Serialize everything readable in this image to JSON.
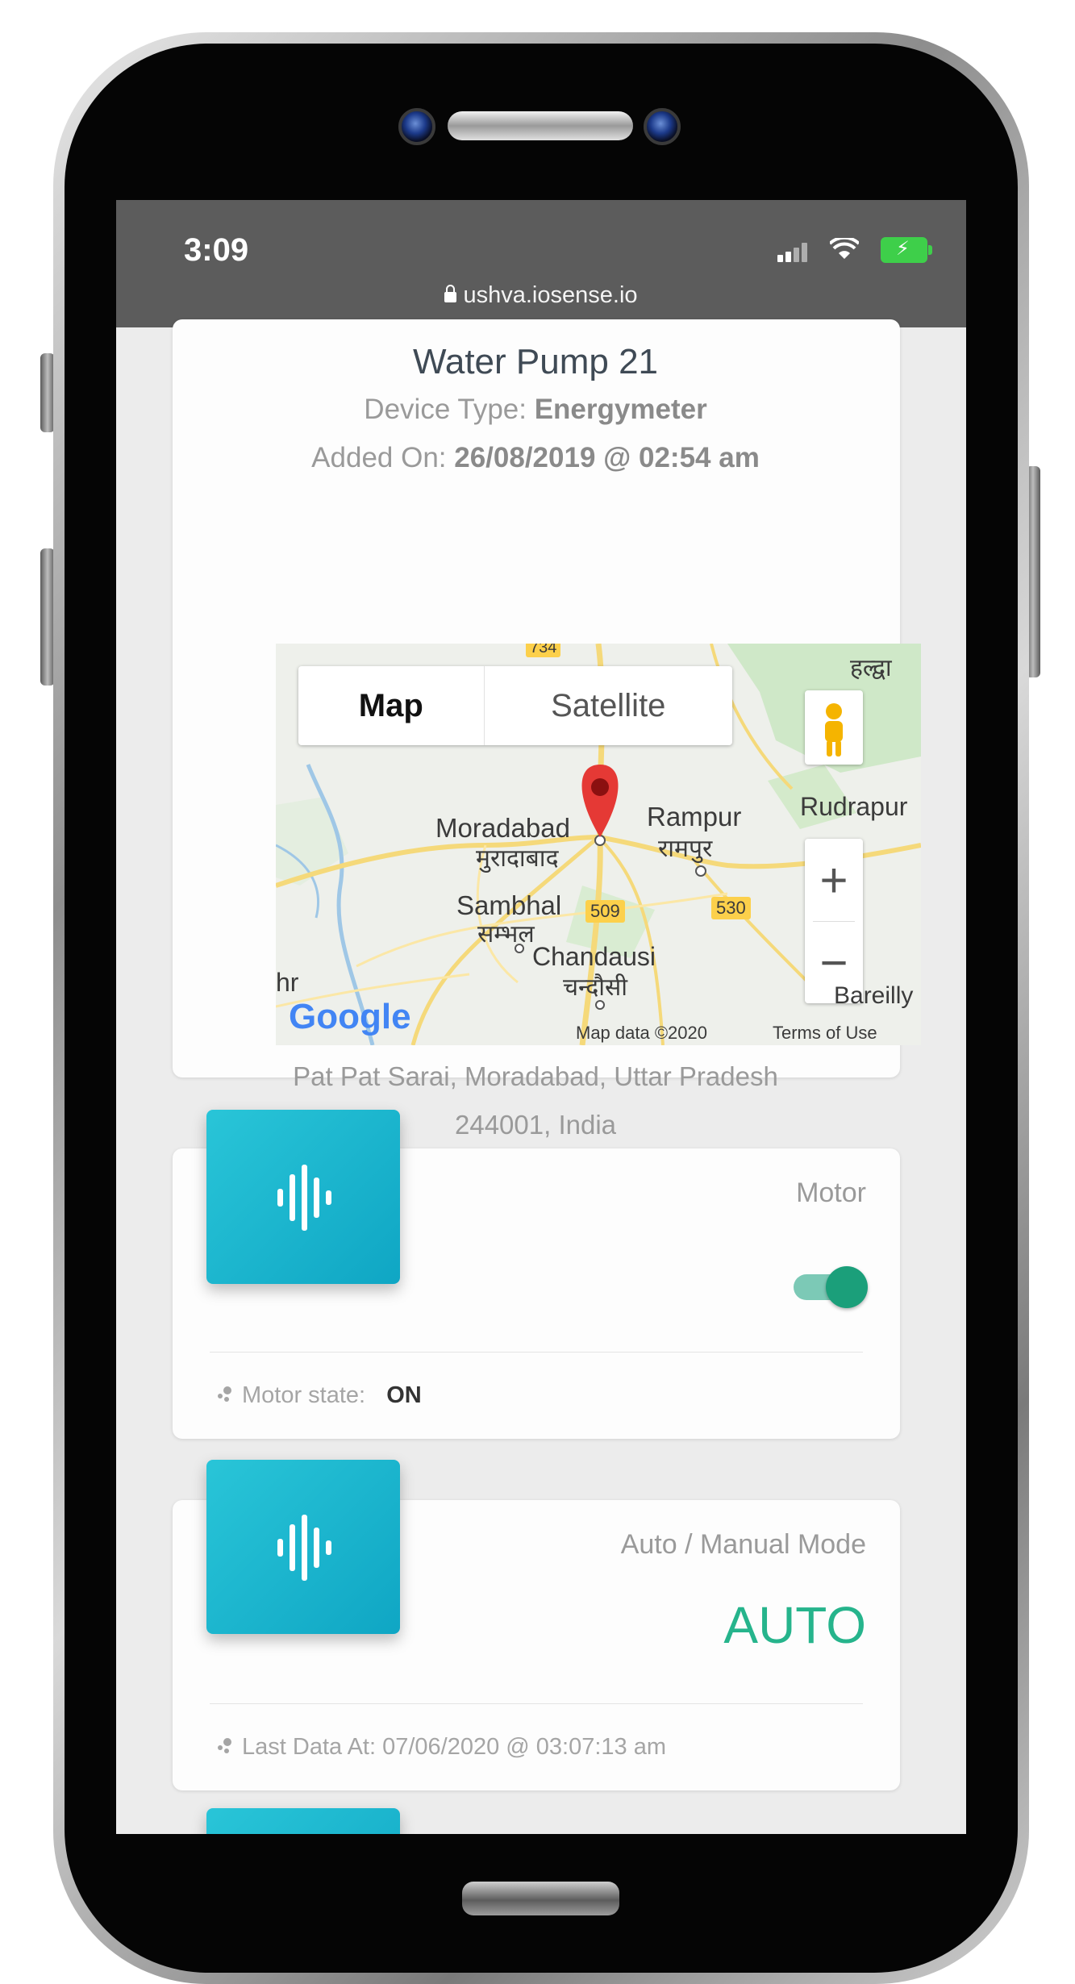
{
  "status_bar": {
    "time": "3:09",
    "url": "ushva.iosense.io",
    "icons": [
      "lock-icon",
      "cell-signal-icon",
      "wifi-icon",
      "battery-charging-icon"
    ]
  },
  "device_card": {
    "title": "Water Pump 21",
    "device_type_label": "Device Type: ",
    "device_type_value": "Energymeter",
    "added_on_label": "Added On: ",
    "added_on_value": "26/08/2019 @ 02:54 am",
    "address_line1": "Pat Pat Sarai, Moradabad, Uttar Pradesh",
    "address_line2": "244001, India"
  },
  "map": {
    "tab_map": "Map",
    "tab_satellite": "Satellite",
    "zoom_in": "+",
    "zoom_out": "−",
    "google": "Google",
    "attribution": "Map data ©2020",
    "terms": "Terms of Use",
    "labels": {
      "moradabad": "Moradabad",
      "moradabad_hi": "मुरादाबाद",
      "rampur": "Rampur",
      "rampur_hi": "रामपुर",
      "rudrapur": "Rudrapur",
      "sambhal": "Sambhal",
      "sambhal_hi": "सम्भल",
      "chandausi": "Chandausi",
      "chandausi_hi": "चन्दौसी",
      "haldwani_hi": "हल्द्वा",
      "bareilly": "Bareilly",
      "hr": "hr",
      "road_509": "509",
      "road_530": "530",
      "road_734": "734"
    }
  },
  "motor_card": {
    "title": "Motor",
    "toggle_on": true,
    "state_label": "Motor state:",
    "state_value": "ON"
  },
  "mode_card": {
    "title": "Auto / Manual Mode",
    "value": "AUTO",
    "last_data": "Last Data At: 07/06/2020 @ 03:07:13 am"
  },
  "colors": {
    "tile": "#12aac7",
    "accent_green": "#1b9f7a",
    "auto_text": "#26b48c",
    "status_bar": "#5c5c5c"
  }
}
